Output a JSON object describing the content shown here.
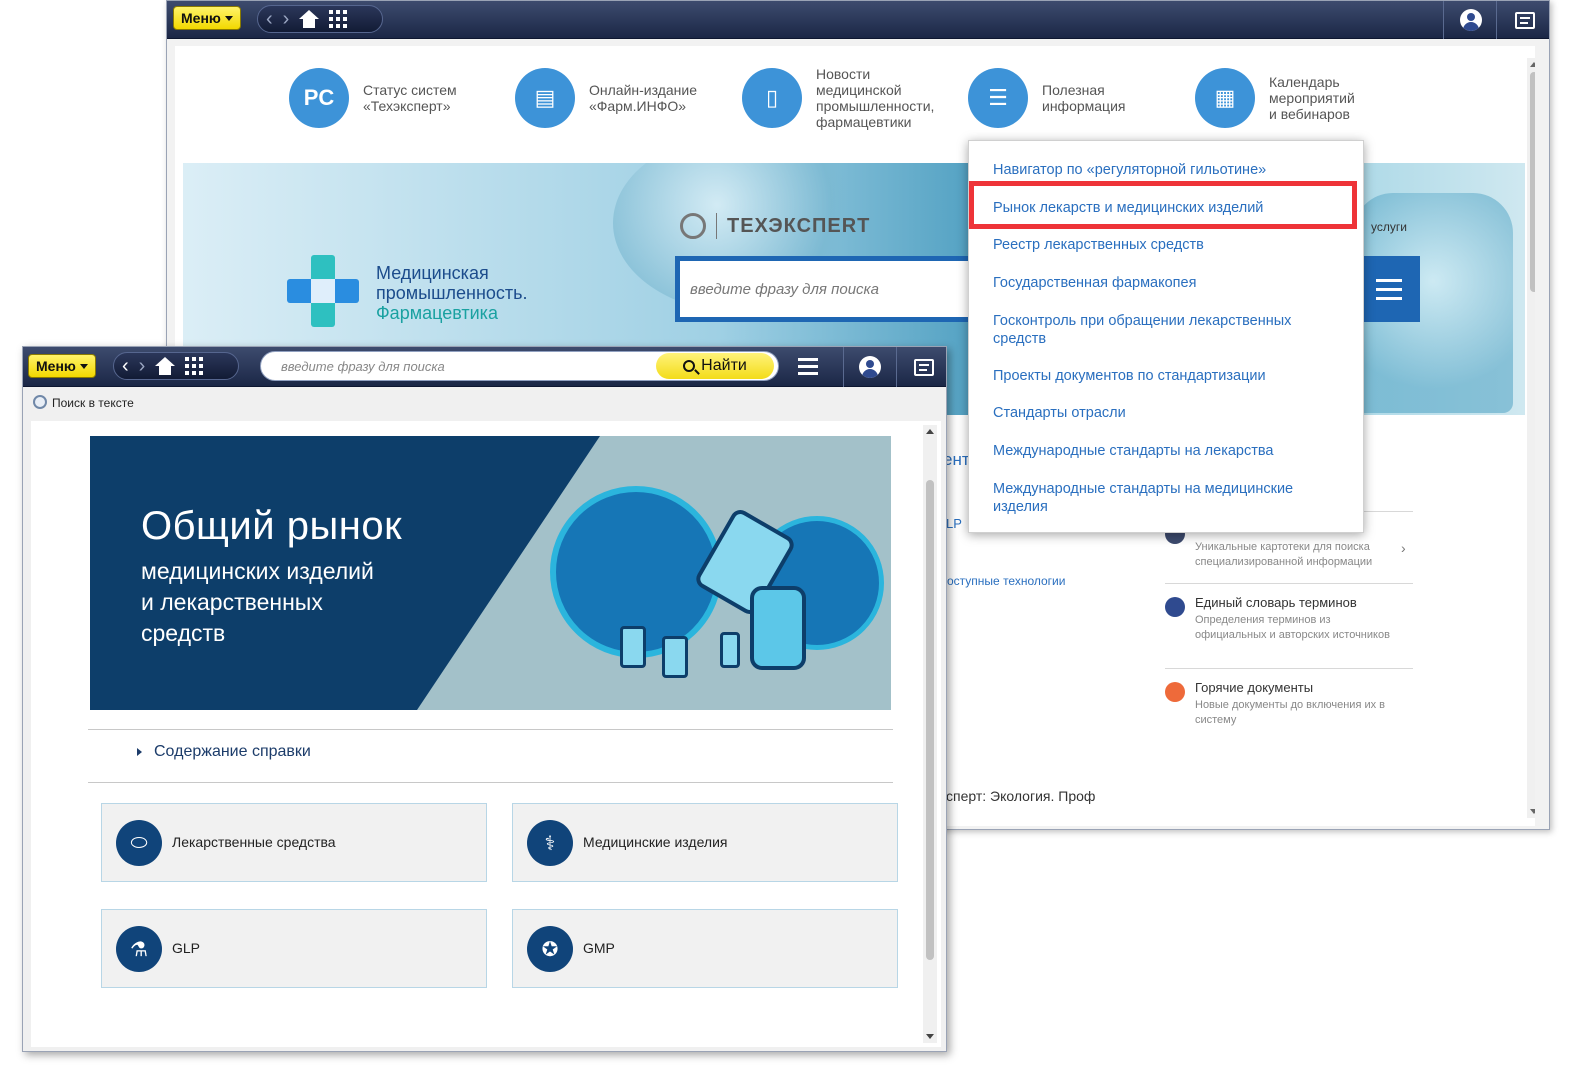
{
  "back_window": {
    "toolbar": {
      "menu_label": "Меню"
    },
    "services": [
      {
        "label": "Статус систем\n«Техэксперт»",
        "icon": "rs-status-icon"
      },
      {
        "label": "Онлайн-издание\n«Фарм.ИНФО»",
        "icon": "monitor-icon"
      },
      {
        "label": "Новости\nмедицинской\nпромышленности,\nфармацевтики",
        "icon": "news-icon"
      },
      {
        "label": "Полезная\nинформация",
        "icon": "info-list-icon"
      },
      {
        "label": "Календарь\nмероприятий\nи вебинаров",
        "icon": "calendar-icon"
      }
    ],
    "hero": {
      "title_line1": "Медицинская",
      "title_line2": "промышленность.",
      "title_line3": "Фармацевтика",
      "brand": "ТЕХЭКСПЕRТ",
      "search_placeholder": "введите фразу для поиска",
      "services_fragment": "услуги"
    },
    "fragments": {
      "ent": "ент",
      "lp": "LP",
      "tech": "оступные технологии",
      "ecology": "сперт: Экология. Проф"
    },
    "side_items": [
      {
        "title": "",
        "desc": "Уникальные картотеки для поиска специализированной информации"
      },
      {
        "title": "Единый словарь терминов",
        "desc": "Определения терминов из официальных и авторских источников"
      },
      {
        "title": "Горячие документы",
        "desc": "Новые документы до включения их в систему"
      }
    ],
    "dropdown": [
      "Навигатор по «регуляторной гильотине»",
      "Рынок лекарств и медицинских изделий",
      "Реестр лекарственных средств",
      "Государственная фармакопея",
      "Госконтроль при обращении лекарственных средств",
      "Проекты документов по стандартизации",
      "Стандарты отрасли",
      "Международные стандарты на лекарства",
      "Международные стандарты на медицинские изделия"
    ],
    "highlight_color": "#ee3338"
  },
  "front_window": {
    "toolbar": {
      "menu_label": "Меню",
      "search_placeholder": "введите фразу для поиска",
      "find_label": "Найти"
    },
    "subbar_label": "Поиск в тексте",
    "banner": {
      "title": "Общий рынок",
      "subtitle": "медицинских изделий\nи лекарственных\nсредств"
    },
    "toc_label": "Содержание справки",
    "tiles": [
      {
        "label": "Лекарственные средства",
        "icon": "pills-icon"
      },
      {
        "label": "Медицинские изделия",
        "icon": "stethoscope-icon"
      },
      {
        "label": "GLP",
        "icon": "test-tubes-icon"
      },
      {
        "label": "GMP",
        "icon": "award-badge-icon"
      }
    ]
  },
  "colors": {
    "toolbar_dark": "#1b2746",
    "menu_yellow": "#f2d800",
    "link_blue": "#2a6fbf",
    "banner_navy": "#0d3e6a"
  }
}
